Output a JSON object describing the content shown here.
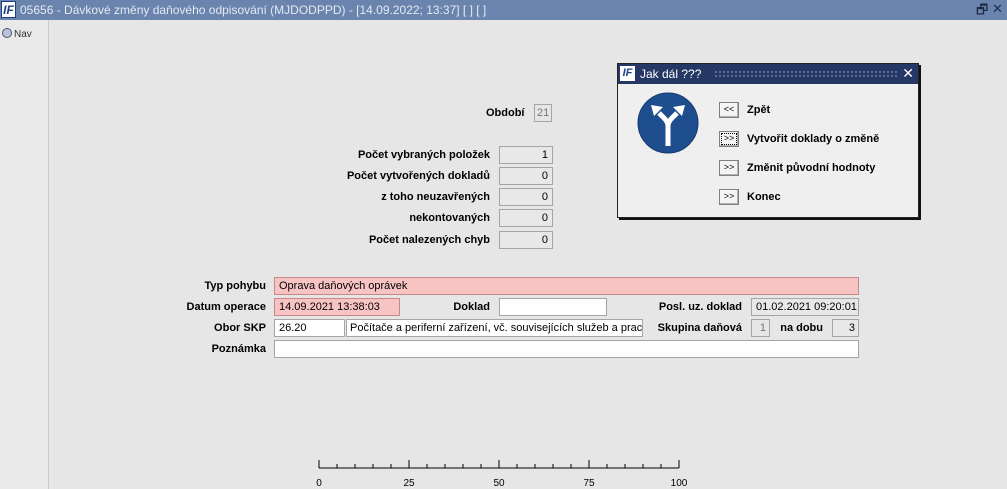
{
  "window": {
    "title": "05656 - Dávkové změny daňového odpisování (MJDODPPD) - [14.09.2022; 13:37]  [ ]  [ ]",
    "logo_text": "IF",
    "restore_glyph": "🗗",
    "close_glyph": "✕"
  },
  "nav": {
    "label": "Nav"
  },
  "stats": {
    "period_label": "Období",
    "period_value": "21",
    "selected_label": "Počet vybraných položek",
    "selected_value": "1",
    "created_label": "Počet vytvořených dokladů",
    "created_value": "0",
    "unclosed_label": "z toho  neuzavřených",
    "unclosed_value": "0",
    "unposted_label": "nekontovaných",
    "unposted_value": "0",
    "errors_label": "Počet nalezených chyb",
    "errors_value": "0"
  },
  "form": {
    "movement_type_label": "Typ pohybu",
    "movement_type_value": "Oprava daňových oprávek",
    "operation_date_label": "Datum operace",
    "operation_date_value": "14.09.2021 13:38:03",
    "document_label": "Doklad",
    "document_value": "",
    "last_doc_label": "Posl. uz. doklad",
    "last_doc_value": "01.02.2021 09:20:01",
    "skp_label": "Obor SKP",
    "skp_code": "26.20",
    "skp_name": "Počítače a periferní zařízení, vč. souvisejících služeb a prací",
    "tax_group_label": "Skupina daňová",
    "tax_group_value": "1",
    "period_for_label": "na dobu",
    "period_for_value": "3",
    "note_label": "Poznámka",
    "note_value": ""
  },
  "dialog": {
    "title": "Jak dál ???",
    "close_glyph": "✕",
    "icon": "fork-arrow-icon",
    "buttons": [
      {
        "glyph": "<<",
        "label": "Zpět"
      },
      {
        "glyph": ">>",
        "label": "Vytvořit doklady o změně"
      },
      {
        "glyph": ">>",
        "label": "Změnit původní hodnoty"
      },
      {
        "glyph": ">>",
        "label": "Konec"
      }
    ]
  },
  "progress": {
    "ticks": [
      "0",
      "25",
      "50",
      "75",
      "100"
    ],
    "value": 0
  }
}
